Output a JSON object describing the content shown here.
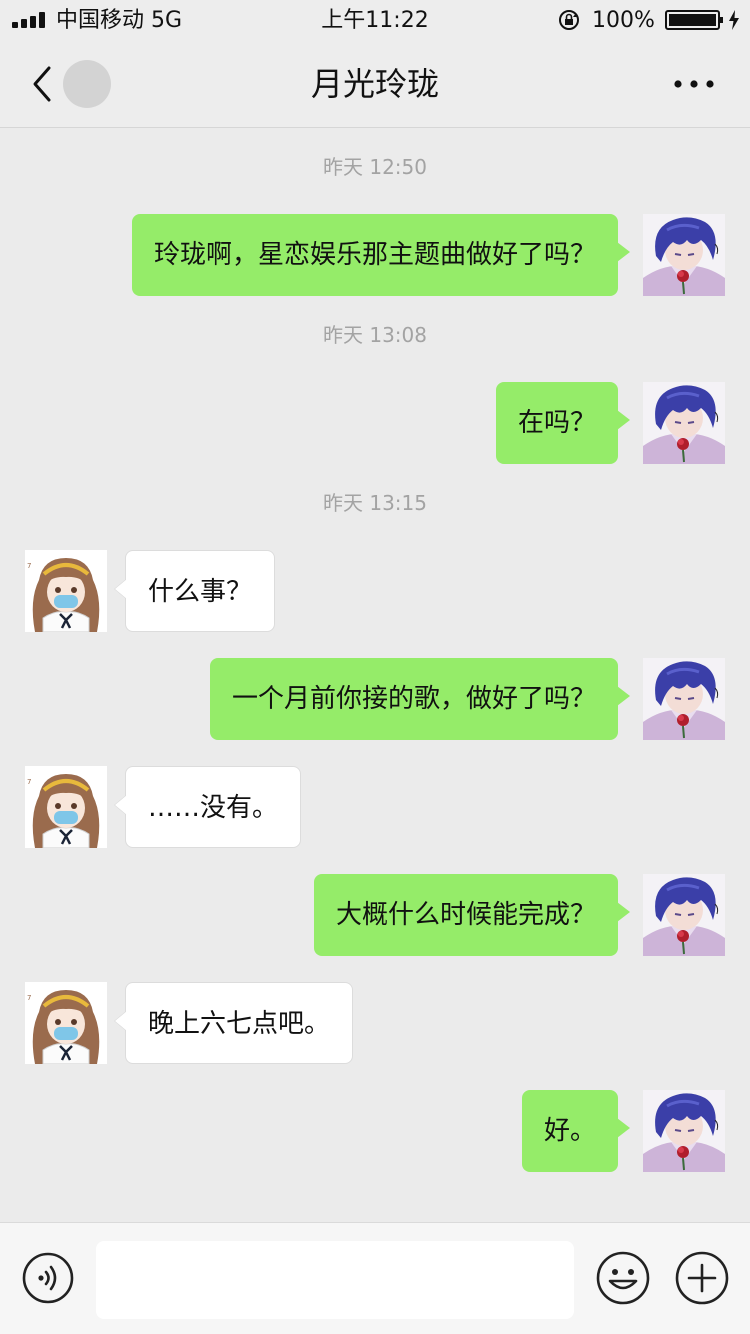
{
  "status_bar": {
    "carrier": "中国移动  5G",
    "time": "上午11:22",
    "battery": "100%",
    "icons": [
      "signal-bars-icon",
      "orientation-lock-icon",
      "battery-icon",
      "charging-bolt-icon"
    ]
  },
  "nav": {
    "title": "月光玲珑",
    "back_icon": "chevron-left-icon",
    "more_icon": "more-dots-icon"
  },
  "timestamps": [
    "昨天 12:50",
    "昨天 13:08",
    "昨天 13:15"
  ],
  "messages": [
    {
      "from": "me",
      "text": "玲珑啊，星恋娱乐那主题曲做好了吗？"
    },
    {
      "from": "me",
      "text": "在吗？"
    },
    {
      "from": "them",
      "text": "什么事？"
    },
    {
      "from": "me",
      "text": "一个月前你接的歌，做好了吗？"
    },
    {
      "from": "them",
      "text": "……没有。"
    },
    {
      "from": "me",
      "text": "大概什么时候能完成？"
    },
    {
      "from": "them",
      "text": "晚上六七点吧。"
    },
    {
      "from": "me",
      "text": "好。"
    }
  ],
  "input_bar": {
    "value": "",
    "icons": [
      "voice-icon",
      "emoji-icon",
      "plus-icon"
    ]
  },
  "colors": {
    "outgoing_bubble": "#95ec69",
    "incoming_bubble": "#ffffff",
    "chat_background": "#ebebeb",
    "timestamp_text": "#a3a3a3"
  }
}
